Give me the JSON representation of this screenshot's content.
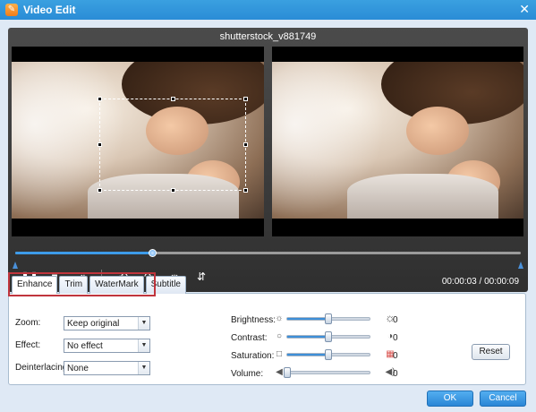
{
  "window": {
    "title": "Video Edit",
    "app_icon": "app-logo-icon",
    "close_icon": "close-icon"
  },
  "preview": {
    "file_name": "shutterstock_v881749",
    "timecode": "00:00:03 / 00:00:09",
    "progress": 0.27
  },
  "controls": [
    "pause-icon",
    "stop-icon",
    "exit-fullscreen-icon",
    "rotate-left-icon",
    "rotate-right-icon",
    "flip-horizontal-icon",
    "flip-vertical-icon"
  ],
  "tabs": [
    {
      "label": "Enhance",
      "active": true
    },
    {
      "label": "Trim",
      "active": false
    },
    {
      "label": "WaterMark",
      "active": false
    },
    {
      "label": "Subtitle",
      "active": false
    }
  ],
  "enhance": {
    "zoom": {
      "label": "Zoom:",
      "value": "Keep original"
    },
    "effect": {
      "label": "Effect:",
      "value": "No effect"
    },
    "deinterlacing": {
      "label": "Deinterlacing:",
      "value": "None"
    },
    "brightness": {
      "label": "Brightness:",
      "value": "0",
      "level": 0.5
    },
    "contrast": {
      "label": "Contrast:",
      "value": "0",
      "level": 0.5
    },
    "saturation": {
      "label": "Saturation:",
      "value": "0",
      "level": 0.5
    },
    "volume": {
      "label": "Volume:",
      "value": "0",
      "level": 0.0
    },
    "reset_label": "Reset"
  },
  "footer": {
    "ok_label": "OK",
    "cancel_label": "Cancel"
  },
  "colors": {
    "title_bar": "#2a8cd6",
    "accent": "#3d9be9",
    "highlight": "#c0353d",
    "player_bg": "#3a3a3a"
  }
}
